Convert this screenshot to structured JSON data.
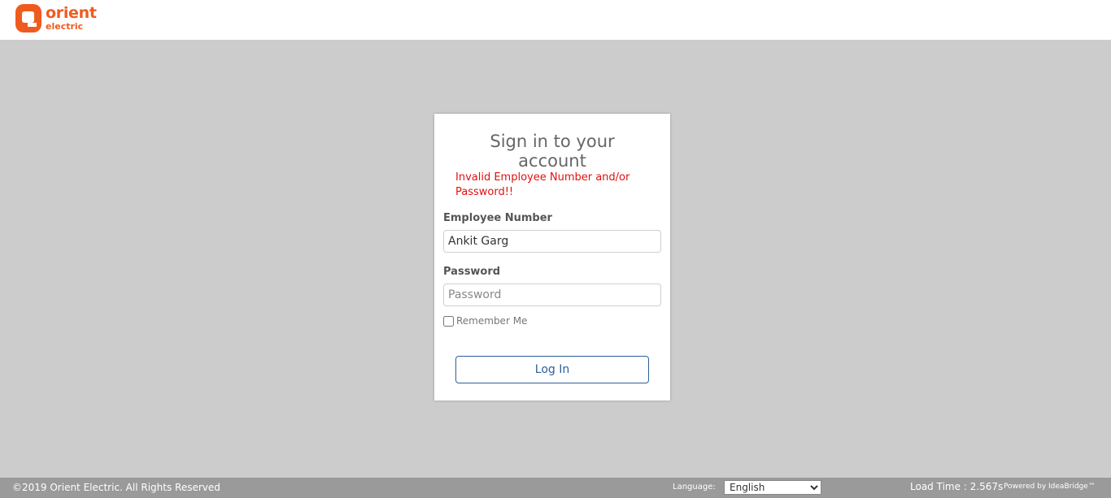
{
  "brand": {
    "name_line1": "orient",
    "name_line2": "electric",
    "color": "#ef5b1f",
    "icon": "orient-logo-icon"
  },
  "login": {
    "title": "Sign in to your account",
    "error": "Invalid Employee Number and/or Password!!",
    "employee_label": "Employee Number",
    "employee_value": "Ankit Garg",
    "password_label": "Password",
    "password_placeholder": "Password",
    "remember_label": "Remember Me",
    "remember_checked": false,
    "button_label": "Log In",
    "button_color": "#2d5f9a",
    "error_color": "#e01010"
  },
  "footer": {
    "copyright": "©2019 Orient Electric. All Rights Reserved",
    "language_label": "Language:",
    "language_selected": "English",
    "load_time": "Load Time : 2.567s",
    "powered_by": "Powered by IdeaBridge™",
    "background": "#9a9a9a"
  },
  "page": {
    "background": "#cccccc"
  }
}
